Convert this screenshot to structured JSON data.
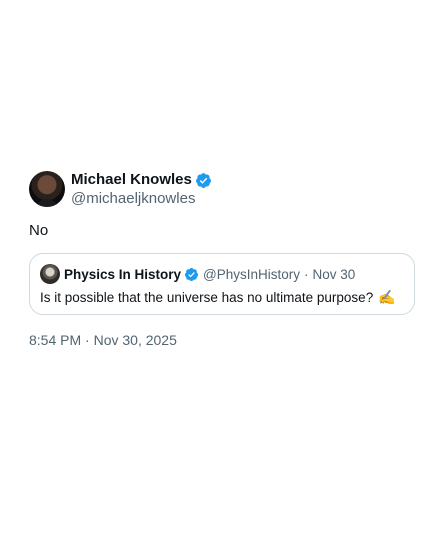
{
  "tweet": {
    "author": {
      "display_name": "Michael Knowles",
      "handle": "@michaeljknowles",
      "verified": true
    },
    "text": "No",
    "quoted_tweet": {
      "author": {
        "display_name": "Physics In History",
        "handle": "@PhysInHistory",
        "verified": true
      },
      "separator": "·",
      "date": "Nov 30",
      "text": "Is it possible that the universe has no ultimate purpose?",
      "emoji": "✍️"
    },
    "timestamp": "8:54 PM · Nov 30, 2025"
  },
  "colors": {
    "verified_badge": "#1d9bf0",
    "secondary_text": "#536471",
    "primary_text": "#0f1419",
    "border": "#cfd9de"
  },
  "icons": {
    "verified": "verified-badge-icon",
    "avatar": "profile-photo",
    "quote_avatar": "profile-photo"
  }
}
